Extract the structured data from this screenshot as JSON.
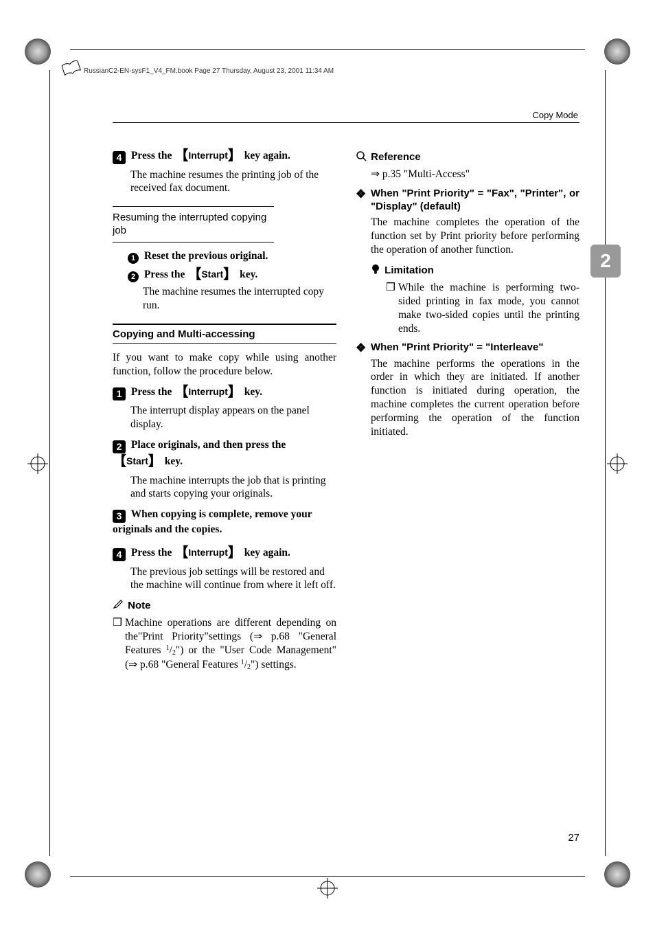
{
  "meta": {
    "header_line": "RussianC2-EN-sysF1_V4_FM.book  Page 27  Thursday, August 23, 2001  11:34 AM",
    "top_label": "Copy Mode",
    "page_number": "27",
    "side_tab": "2"
  },
  "left": {
    "step4a": {
      "num": "4",
      "text_pre": "Press the ",
      "key": "Interrupt",
      "text_post": " key again."
    },
    "step4a_body": "The machine resumes the printing job of the received fax document.",
    "resume_heading": "Resuming the interrupted copying job",
    "sub1": {
      "num": "1",
      "text": "Reset the previous original."
    },
    "sub2": {
      "num": "2",
      "text_pre": "Press the ",
      "key": "Start",
      "text_post": " key."
    },
    "sub2_body": "The machine resumes the interrupted copy run.",
    "section_heading": "Copying and Multi-accessing",
    "intro": "If you want to make copy while using another function, follow the procedure below.",
    "b_step1": {
      "num": "1",
      "text_pre": "Press the ",
      "key": "Interrupt",
      "text_post": " key."
    },
    "b_step1_body": "The interrupt display appears on the panel display.",
    "b_step2": {
      "num": "2",
      "text_pre": "Place originals, and then press the ",
      "key": "Start",
      "text_post": " key."
    },
    "b_step2_body": "The machine interrupts the job that is printing and starts copying your originals.",
    "b_step3": {
      "num": "3",
      "text": "When copying is complete, remove your originals and the copies."
    },
    "b_step4": {
      "num": "4",
      "text_pre": "Press the ",
      "key": "Interrupt",
      "text_post": " key again."
    },
    "b_step4_body": "The previous job settings will be restored and the machine will continue from where it left off.",
    "note_head": "Note",
    "note_item": "Machine operations are different depending on the\"Print Priority\"settings (⇒ p.68 \"General Features 1/2\") or the \"User Code Management\" (⇒ p.68 \"General Features 1/2\") settings."
  },
  "right": {
    "ref_head": "Reference",
    "ref_item": "⇒ p.35 \"Multi-Access\"",
    "d1_head": "When \"Print Priority\" = \"Fax\", \"Printer\", or \"Display\" (default)",
    "d1_body": "The machine completes the operation of the function set by Print priority before performing the operation of another function.",
    "lim_head": "Limitation",
    "lim_item": "While the machine is performing two-sided printing in fax mode, you cannot make two-sided copies until the printing ends.",
    "d2_head": "When \"Print Priority\" = \"Interleave\"",
    "d2_body": "The machine performs the operations in the order in which they are initiated. If another function is initiated during operation, the machine completes the current operation before performing the operation of the function initiated."
  }
}
